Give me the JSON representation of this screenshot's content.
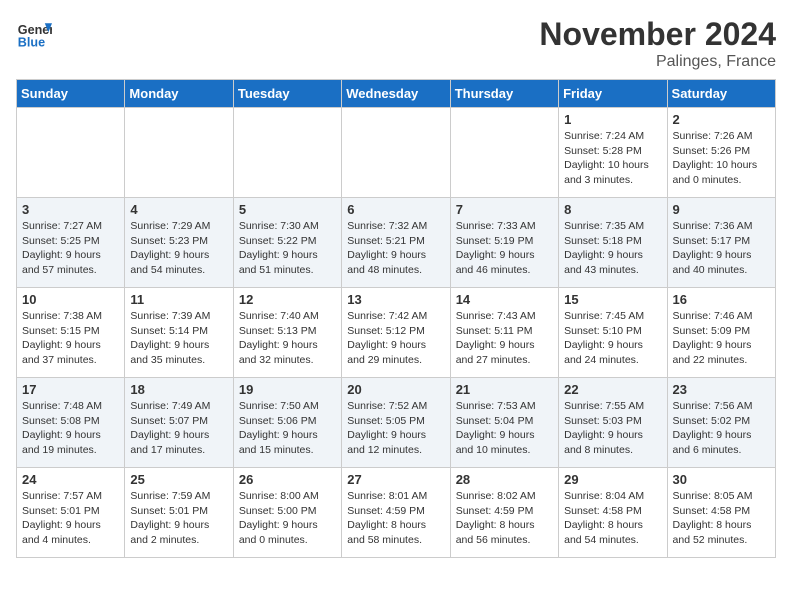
{
  "header": {
    "logo_general": "General",
    "logo_blue": "Blue",
    "title": "November 2024",
    "subtitle": "Palinges, France"
  },
  "weekdays": [
    "Sunday",
    "Monday",
    "Tuesday",
    "Wednesday",
    "Thursday",
    "Friday",
    "Saturday"
  ],
  "weeks": [
    [
      {
        "day": "",
        "info": ""
      },
      {
        "day": "",
        "info": ""
      },
      {
        "day": "",
        "info": ""
      },
      {
        "day": "",
        "info": ""
      },
      {
        "day": "",
        "info": ""
      },
      {
        "day": "1",
        "info": "Sunrise: 7:24 AM\nSunset: 5:28 PM\nDaylight: 10 hours and 3 minutes."
      },
      {
        "day": "2",
        "info": "Sunrise: 7:26 AM\nSunset: 5:26 PM\nDaylight: 10 hours and 0 minutes."
      }
    ],
    [
      {
        "day": "3",
        "info": "Sunrise: 7:27 AM\nSunset: 5:25 PM\nDaylight: 9 hours and 57 minutes."
      },
      {
        "day": "4",
        "info": "Sunrise: 7:29 AM\nSunset: 5:23 PM\nDaylight: 9 hours and 54 minutes."
      },
      {
        "day": "5",
        "info": "Sunrise: 7:30 AM\nSunset: 5:22 PM\nDaylight: 9 hours and 51 minutes."
      },
      {
        "day": "6",
        "info": "Sunrise: 7:32 AM\nSunset: 5:21 PM\nDaylight: 9 hours and 48 minutes."
      },
      {
        "day": "7",
        "info": "Sunrise: 7:33 AM\nSunset: 5:19 PM\nDaylight: 9 hours and 46 minutes."
      },
      {
        "day": "8",
        "info": "Sunrise: 7:35 AM\nSunset: 5:18 PM\nDaylight: 9 hours and 43 minutes."
      },
      {
        "day": "9",
        "info": "Sunrise: 7:36 AM\nSunset: 5:17 PM\nDaylight: 9 hours and 40 minutes."
      }
    ],
    [
      {
        "day": "10",
        "info": "Sunrise: 7:38 AM\nSunset: 5:15 PM\nDaylight: 9 hours and 37 minutes."
      },
      {
        "day": "11",
        "info": "Sunrise: 7:39 AM\nSunset: 5:14 PM\nDaylight: 9 hours and 35 minutes."
      },
      {
        "day": "12",
        "info": "Sunrise: 7:40 AM\nSunset: 5:13 PM\nDaylight: 9 hours and 32 minutes."
      },
      {
        "day": "13",
        "info": "Sunrise: 7:42 AM\nSunset: 5:12 PM\nDaylight: 9 hours and 29 minutes."
      },
      {
        "day": "14",
        "info": "Sunrise: 7:43 AM\nSunset: 5:11 PM\nDaylight: 9 hours and 27 minutes."
      },
      {
        "day": "15",
        "info": "Sunrise: 7:45 AM\nSunset: 5:10 PM\nDaylight: 9 hours and 24 minutes."
      },
      {
        "day": "16",
        "info": "Sunrise: 7:46 AM\nSunset: 5:09 PM\nDaylight: 9 hours and 22 minutes."
      }
    ],
    [
      {
        "day": "17",
        "info": "Sunrise: 7:48 AM\nSunset: 5:08 PM\nDaylight: 9 hours and 19 minutes."
      },
      {
        "day": "18",
        "info": "Sunrise: 7:49 AM\nSunset: 5:07 PM\nDaylight: 9 hours and 17 minutes."
      },
      {
        "day": "19",
        "info": "Sunrise: 7:50 AM\nSunset: 5:06 PM\nDaylight: 9 hours and 15 minutes."
      },
      {
        "day": "20",
        "info": "Sunrise: 7:52 AM\nSunset: 5:05 PM\nDaylight: 9 hours and 12 minutes."
      },
      {
        "day": "21",
        "info": "Sunrise: 7:53 AM\nSunset: 5:04 PM\nDaylight: 9 hours and 10 minutes."
      },
      {
        "day": "22",
        "info": "Sunrise: 7:55 AM\nSunset: 5:03 PM\nDaylight: 9 hours and 8 minutes."
      },
      {
        "day": "23",
        "info": "Sunrise: 7:56 AM\nSunset: 5:02 PM\nDaylight: 9 hours and 6 minutes."
      }
    ],
    [
      {
        "day": "24",
        "info": "Sunrise: 7:57 AM\nSunset: 5:01 PM\nDaylight: 9 hours and 4 minutes."
      },
      {
        "day": "25",
        "info": "Sunrise: 7:59 AM\nSunset: 5:01 PM\nDaylight: 9 hours and 2 minutes."
      },
      {
        "day": "26",
        "info": "Sunrise: 8:00 AM\nSunset: 5:00 PM\nDaylight: 9 hours and 0 minutes."
      },
      {
        "day": "27",
        "info": "Sunrise: 8:01 AM\nSunset: 4:59 PM\nDaylight: 8 hours and 58 minutes."
      },
      {
        "day": "28",
        "info": "Sunrise: 8:02 AM\nSunset: 4:59 PM\nDaylight: 8 hours and 56 minutes."
      },
      {
        "day": "29",
        "info": "Sunrise: 8:04 AM\nSunset: 4:58 PM\nDaylight: 8 hours and 54 minutes."
      },
      {
        "day": "30",
        "info": "Sunrise: 8:05 AM\nSunset: 4:58 PM\nDaylight: 8 hours and 52 minutes."
      }
    ]
  ]
}
